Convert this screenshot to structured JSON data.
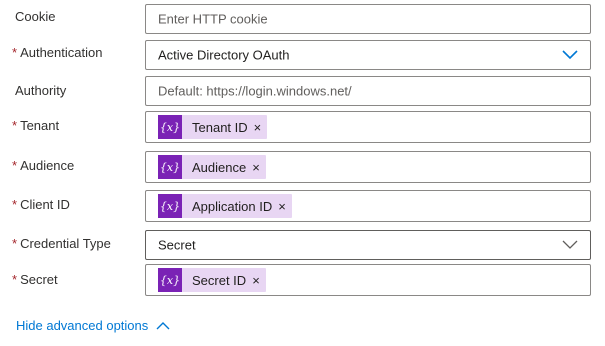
{
  "fields": {
    "cookie": {
      "label": "Cookie",
      "required": "",
      "placeholder": "Enter HTTP cookie"
    },
    "authentication": {
      "label": "Authentication",
      "required": "*",
      "value": "Active Directory OAuth"
    },
    "authority": {
      "label": "Authority",
      "required": "",
      "placeholder": "Default: https://login.windows.net/"
    },
    "tenant": {
      "label": "Tenant",
      "required": "*",
      "token_icon": "{x}",
      "token": "Tenant ID",
      "remove": "×"
    },
    "audience": {
      "label": "Audience",
      "required": "*",
      "token_icon": "{x}",
      "token": "Audience",
      "remove": "×"
    },
    "client_id": {
      "label": "Client ID",
      "required": "*",
      "token_icon": "{x}",
      "token": "Application ID",
      "remove": "×"
    },
    "credential_type": {
      "label": "Credential Type",
      "required": "*",
      "value": "Secret"
    },
    "secret": {
      "label": "Secret",
      "required": "*",
      "token_icon": "{x}",
      "token": "Secret ID",
      "remove": "×"
    }
  },
  "advanced_link": {
    "label": "Hide advanced options"
  },
  "icons": {
    "token": "variable-icon",
    "dropdown": "chevron-down-icon",
    "collapse": "chevron-up-icon",
    "remove": "close-icon"
  },
  "colors": {
    "required": "#a4262c",
    "accent": "#0078d4",
    "token_bg": "#e8d6f3",
    "token_icon_bg": "#7a22b5",
    "border": "#8a8886"
  }
}
